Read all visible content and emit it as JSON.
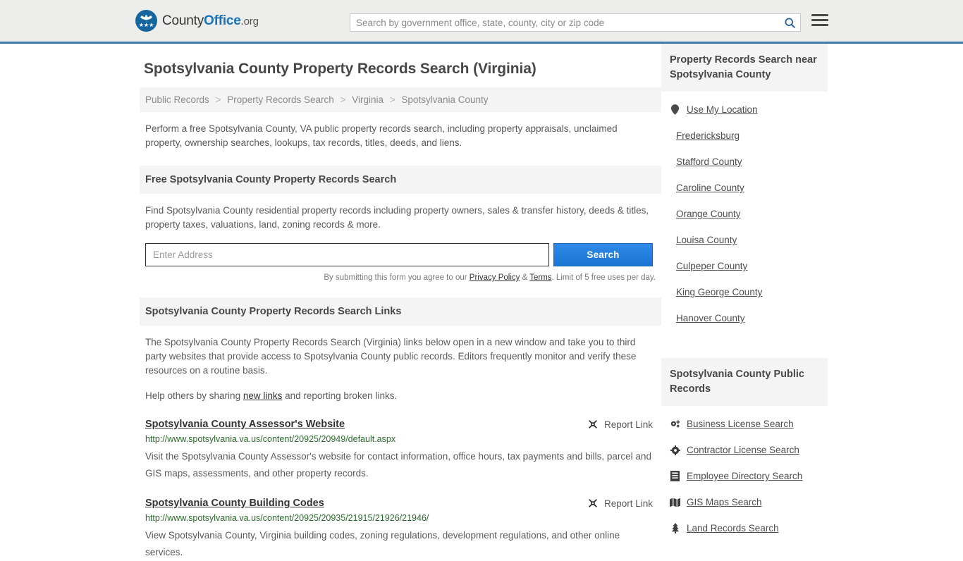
{
  "header": {
    "brand": {
      "part1": "County",
      "part2": "Office",
      "part3": ".org",
      "logo_icon": "eagle-stars-logo",
      "logo_color": "#17659e"
    },
    "search": {
      "placeholder": "Search by government office, state, county, city or zip code",
      "value": "",
      "submit_icon": "search-icon"
    },
    "menu_icon": "hamburger-menu-icon",
    "accent_color": "#3c78a8",
    "background": "#ededeb"
  },
  "main": {
    "page_title": "Spotsylvania County Property Records Search (Virginia)",
    "breadcrumb": [
      {
        "label": "Public Records"
      },
      {
        "label": "Property Records Search"
      },
      {
        "label": "Virginia"
      },
      {
        "label": "Spotsylvania County"
      }
    ],
    "breadcrumb_separator": ">",
    "intro": "Perform a free Spotsylvania County, VA public property records search, including property appraisals, unclaimed property, ownership searches, lookups, tax records, titles, deeds, and liens.",
    "search_section": {
      "heading": "Free Spotsylvania County Property Records Search",
      "description": "Find Spotsylvania County residential property records including property owners, sales & transfer history, deeds & titles, property taxes, valuations, land, zoning records & more.",
      "input_placeholder": "Enter Address",
      "input_value": "",
      "button_label": "Search",
      "note_prefix": "By submitting this form you agree to our ",
      "note_privacy": "Privacy Policy",
      "note_amp": " & ",
      "note_terms": "Terms",
      "note_suffix": ". Limit of 5 free uses per day.",
      "button_color": "#1a74d2"
    },
    "links_section": {
      "heading": "Spotsylvania County Property Records Search Links",
      "paragraph": "The Spotsylvania County Property Records Search (Virginia) links below open in a new window and take you to third party websites that provide access to Spotsylvania County public records. Editors frequently monitor and verify these resources on a routine basis.",
      "help_prefix": "Help others by sharing ",
      "help_link": "new links",
      "help_suffix": " and reporting broken links.",
      "report_label": "Report Link",
      "report_icon": "broken-link-icon",
      "items": [
        {
          "title": "Spotsylvania County Assessor's Website",
          "url": "http://www.spotsylvania.va.us/content/20925/20949/default.aspx",
          "description": "Visit the Spotsylvania County Assessor's website for contact information, office hours, tax payments and bills, parcel and GIS maps, assessments, and other property records.",
          "report_label": "Report Link"
        },
        {
          "title": "Spotsylvania County Building Codes",
          "url": "http://www.spotsylvania.va.us/content/20925/20935/21915/21926/21946/",
          "description": "View Spotsylvania County, Virginia building codes, zoning regulations, development regulations, and other online services.",
          "report_label": "Report Link"
        }
      ]
    }
  },
  "sidebar": {
    "nearby": {
      "heading": "Property Records Search near Spotsylvania County",
      "items": [
        {
          "label": "Use My Location",
          "icon": "map-pin-icon"
        },
        {
          "label": "Fredericksburg",
          "icon": ""
        },
        {
          "label": "Stafford County",
          "icon": ""
        },
        {
          "label": "Caroline County",
          "icon": ""
        },
        {
          "label": "Orange County",
          "icon": ""
        },
        {
          "label": "Louisa County",
          "icon": ""
        },
        {
          "label": "Culpeper County",
          "icon": ""
        },
        {
          "label": "King George County",
          "icon": ""
        },
        {
          "label": "Hanover County",
          "icon": ""
        }
      ]
    },
    "public_records": {
      "heading": "Spotsylvania County Public Records",
      "items": [
        {
          "label": "Business License Search",
          "icon": "cogs-icon"
        },
        {
          "label": "Contractor License Search",
          "icon": "cog-icon"
        },
        {
          "label": "Employee Directory Search",
          "icon": "book-icon"
        },
        {
          "label": "GIS Maps Search",
          "icon": "map-icon"
        },
        {
          "label": "Land Records Search",
          "icon": "tree-icon"
        }
      ]
    }
  }
}
